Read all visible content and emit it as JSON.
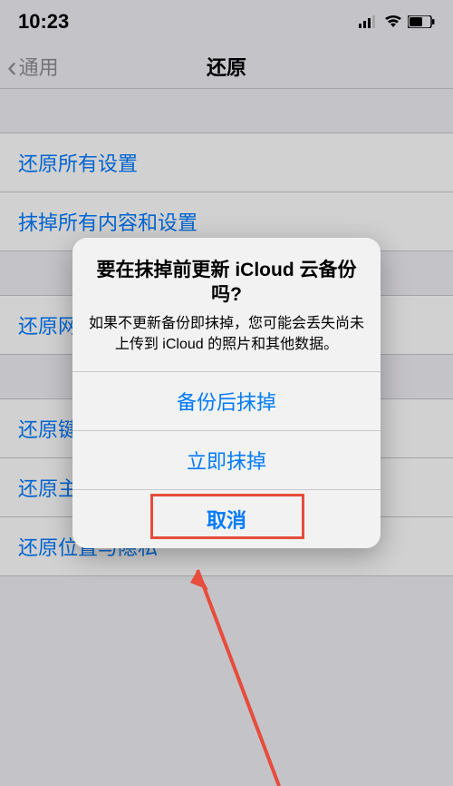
{
  "statusBar": {
    "time": "10:23"
  },
  "nav": {
    "back": "通用",
    "title": "还原"
  },
  "groups": [
    {
      "rows": [
        "还原所有设置",
        "抹掉所有内容和设置"
      ]
    },
    {
      "rows": [
        "还原网络设置"
      ]
    },
    {
      "rows": [
        "还原键盘词典",
        "还原主屏幕布局",
        "还原位置与隐私"
      ]
    }
  ],
  "alert": {
    "title": "要在抹掉前更新 iCloud 云备份吗?",
    "message": "如果不更新备份即抹掉，您可能会丢失尚未上传到 iCloud 的照片和其他数据。",
    "buttons": {
      "backup": "备份后抹掉",
      "erase": "立即抹掉",
      "cancel": "取消"
    }
  },
  "annotation": {
    "highlightColor": "#e74c3c"
  }
}
